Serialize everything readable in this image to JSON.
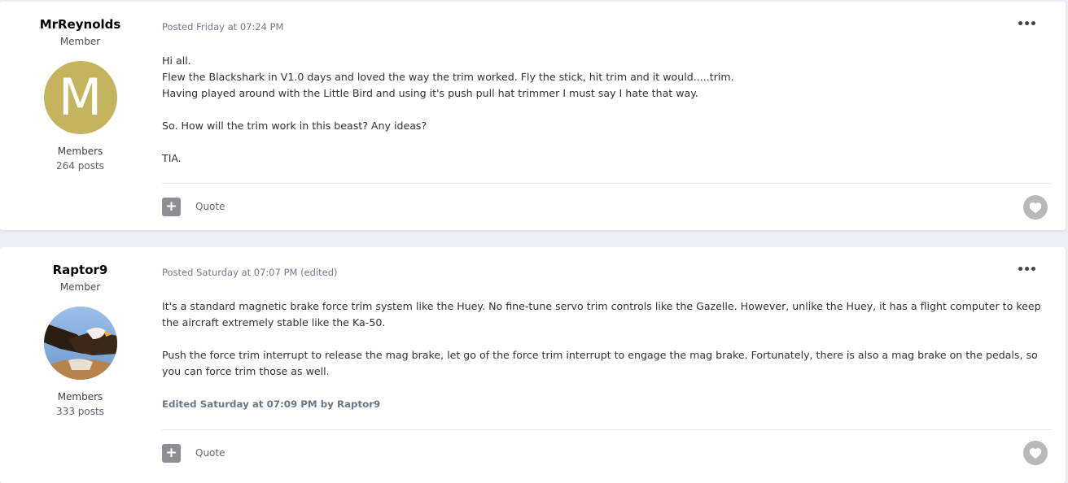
{
  "posts": [
    {
      "author": {
        "name": "MrReynolds",
        "rank": "Member",
        "avatar_letter": "M",
        "avatar_color": "#c4b45e",
        "group": "Members",
        "post_count": "264 posts"
      },
      "posted": "Posted Friday at 07:24 PM",
      "paragraphs": [
        "Hi all.\nFlew the Blackshark in V1.0 days and loved the way the trim worked.  Fly the stick, hit trim and it would.....trim.\nHaving played around with the Little Bird and using it's push pull hat trimmer I must say I hate that way.",
        "So.  How will the trim work in this beast?  Any ideas?",
        "TIA."
      ],
      "menu_icon": "more-icon",
      "multiquote_icon": "plus-icon",
      "multiquote_label": "+",
      "quote_label": "Quote",
      "like_icon": "heart-icon"
    },
    {
      "author": {
        "name": "Raptor9",
        "rank": "Member",
        "avatar_desc": "eagle",
        "group": "Members",
        "post_count": "333 posts"
      },
      "posted": "Posted Saturday at 07:07 PM (edited)",
      "paragraphs": [
        "It's a standard magnetic brake force trim system like the Huey.  No fine-tune servo trim controls like the Gazelle.  However, unlike the Huey, it has a flight computer to keep the aircraft extremely stable like the Ka-50.",
        "Push the force trim interrupt to release the mag brake, let go of the force trim interrupt to engage the mag brake.  Fortunately, there is also a mag brake on the pedals, so you can force trim those as well."
      ],
      "edited_note": "Edited Saturday at 07:09 PM by Raptor9",
      "menu_icon": "more-icon",
      "multiquote_icon": "plus-icon",
      "multiquote_label": "+",
      "quote_label": "Quote",
      "like_icon": "heart-icon"
    }
  ],
  "colors": {
    "page_bg": "#ebeef2",
    "card_bg": "#ffffff",
    "meta_text": "#737b87",
    "like_button": "#b9b9b9"
  }
}
